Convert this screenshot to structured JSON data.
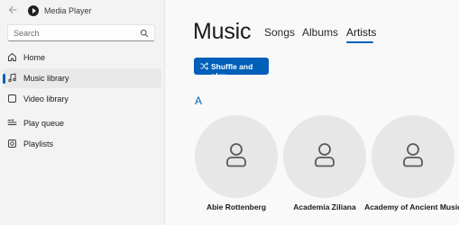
{
  "app": {
    "title": "Media Player"
  },
  "search": {
    "placeholder": "Search"
  },
  "sidebar": {
    "items": [
      {
        "label": "Home",
        "icon": "home-icon"
      },
      {
        "label": "Music library",
        "icon": "music-note-icon",
        "active": true
      },
      {
        "label": "Video library",
        "icon": "video-icon"
      },
      {
        "label": "Play queue",
        "icon": "queue-icon"
      },
      {
        "label": "Playlists",
        "icon": "playlist-icon"
      }
    ]
  },
  "main": {
    "title": "Music",
    "tabs": [
      {
        "label": "Songs"
      },
      {
        "label": "Albums"
      },
      {
        "label": "Artists",
        "active": true
      }
    ],
    "shuffle_label": "Shuffle and play",
    "section_letter": "A",
    "artists": [
      {
        "name": "Abie Rottenberg"
      },
      {
        "name": "Academia Ziliana"
      },
      {
        "name": "Academy of Ancient Music"
      }
    ]
  },
  "colors": {
    "accent": "#005fb8",
    "sidebar_bg": "#f3f3f3",
    "content_bg": "#f9f9f9",
    "avatar_bg": "#e7e7e7"
  }
}
